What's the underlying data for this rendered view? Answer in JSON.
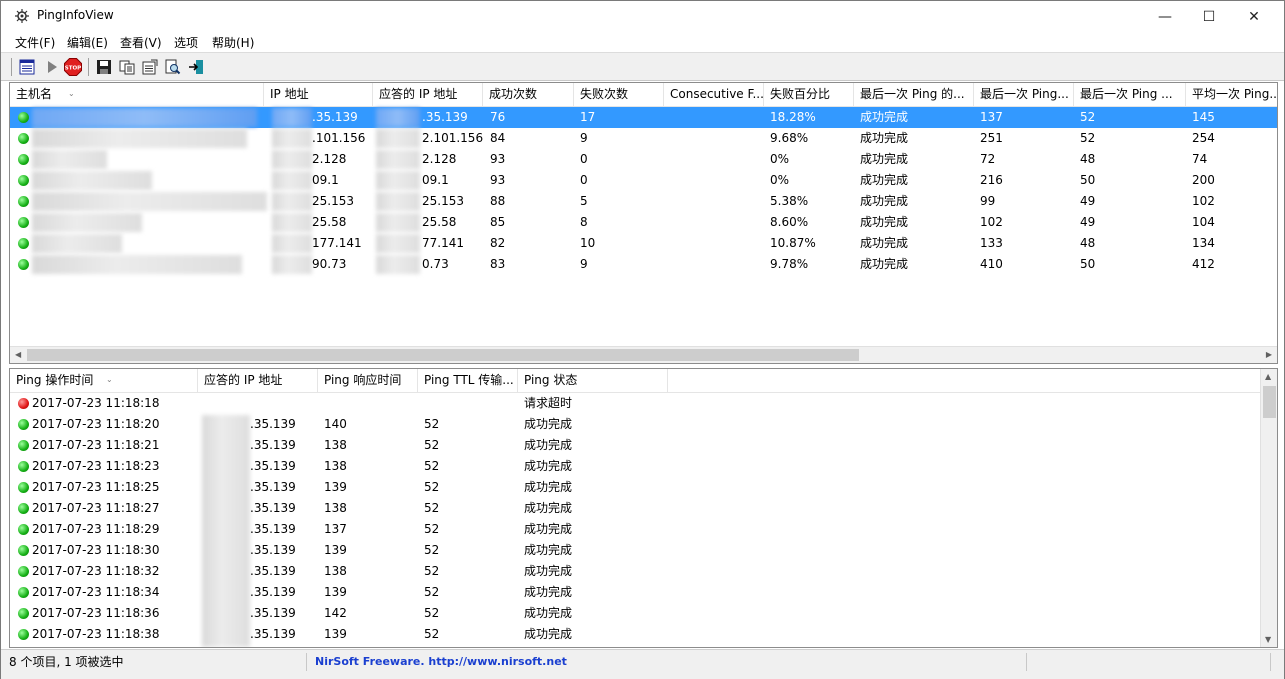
{
  "window": {
    "title": "PingInfoView",
    "minimize": "—",
    "maximize": "☐",
    "close": "✕"
  },
  "menu": [
    "文件(F)",
    "编辑(E)",
    "查看(V)",
    "选项",
    "帮助(H)"
  ],
  "toolbar_icons": [
    "list-icon",
    "play-icon",
    "stop-icon",
    "save-icon",
    "copy-icon",
    "properties-icon",
    "find-icon",
    "exit-icon"
  ],
  "stop_label": "STOP",
  "top_table": {
    "columns": [
      "主机名",
      "IP 地址",
      "应答的 IP 地址",
      "成功次数",
      "失败次数",
      "Consecutive F...",
      "失败百分比",
      "最后一次 Ping 的...",
      "最后一次 Ping...",
      "最后一次 Ping ...",
      "平均一次 Ping..."
    ],
    "rows": [
      {
        "ip": ".35.139",
        "reply_ip": ".35.139",
        "success": "76",
        "fail": "17",
        "consecutive": "",
        "fail_pct": "18.28%",
        "status": "成功完成",
        "last_time": "137",
        "last_ttl": "52",
        "avg": "145"
      },
      {
        "ip": ".101.156",
        "reply_ip": "2.101.156",
        "success": "84",
        "fail": "9",
        "consecutive": "",
        "fail_pct": "9.68%",
        "status": "成功完成",
        "last_time": "251",
        "last_ttl": "52",
        "avg": "254"
      },
      {
        "ip": "2.128",
        "reply_ip": "2.128",
        "success": "93",
        "fail": "0",
        "consecutive": "",
        "fail_pct": "0%",
        "status": "成功完成",
        "last_time": "72",
        "last_ttl": "48",
        "avg": "74"
      },
      {
        "ip": "09.1",
        "reply_ip": "09.1",
        "success": "93",
        "fail": "0",
        "consecutive": "",
        "fail_pct": "0%",
        "status": "成功完成",
        "last_time": "216",
        "last_ttl": "50",
        "avg": "200"
      },
      {
        "ip": "25.153",
        "reply_ip": "25.153",
        "success": "88",
        "fail": "5",
        "consecutive": "",
        "fail_pct": "5.38%",
        "status": "成功完成",
        "last_time": "99",
        "last_ttl": "49",
        "avg": "102"
      },
      {
        "ip": "25.58",
        "reply_ip": "25.58",
        "success": "85",
        "fail": "8",
        "consecutive": "",
        "fail_pct": "8.60%",
        "status": "成功完成",
        "last_time": "102",
        "last_ttl": "49",
        "avg": "104"
      },
      {
        "ip": "177.141",
        "reply_ip": "77.141",
        "success": "82",
        "fail": "10",
        "consecutive": "",
        "fail_pct": "10.87%",
        "status": "成功完成",
        "last_time": "133",
        "last_ttl": "48",
        "avg": "134"
      },
      {
        "ip": "90.73",
        "reply_ip": "0.73",
        "success": "83",
        "fail": "9",
        "consecutive": "",
        "fail_pct": "9.78%",
        "status": "成功完成",
        "last_time": "410",
        "last_ttl": "50",
        "avg": "412"
      }
    ]
  },
  "bottom_table": {
    "columns": [
      "Ping 操作时间",
      "应答的 IP 地址",
      "Ping 响应时间",
      "Ping TTL 传输...",
      "Ping 状态"
    ],
    "rows": [
      {
        "status_color": "red",
        "time": "2017-07-23 11:18:18",
        "reply_ip": "",
        "resp": "",
        "ttl": "",
        "status": "请求超时"
      },
      {
        "status_color": "green",
        "time": "2017-07-23 11:18:20",
        "reply_ip": ".35.139",
        "resp": "140",
        "ttl": "52",
        "status": "成功完成"
      },
      {
        "status_color": "green",
        "time": "2017-07-23 11:18:21",
        "reply_ip": ".35.139",
        "resp": "138",
        "ttl": "52",
        "status": "成功完成"
      },
      {
        "status_color": "green",
        "time": "2017-07-23 11:18:23",
        "reply_ip": ".35.139",
        "resp": "138",
        "ttl": "52",
        "status": "成功完成"
      },
      {
        "status_color": "green",
        "time": "2017-07-23 11:18:25",
        "reply_ip": ".35.139",
        "resp": "139",
        "ttl": "52",
        "status": "成功完成"
      },
      {
        "status_color": "green",
        "time": "2017-07-23 11:18:27",
        "reply_ip": ".35.139",
        "resp": "138",
        "ttl": "52",
        "status": "成功完成"
      },
      {
        "status_color": "green",
        "time": "2017-07-23 11:18:29",
        "reply_ip": ".35.139",
        "resp": "137",
        "ttl": "52",
        "status": "成功完成"
      },
      {
        "status_color": "green",
        "time": "2017-07-23 11:18:30",
        "reply_ip": ".35.139",
        "resp": "139",
        "ttl": "52",
        "status": "成功完成"
      },
      {
        "status_color": "green",
        "time": "2017-07-23 11:18:32",
        "reply_ip": ".35.139",
        "resp": "138",
        "ttl": "52",
        "status": "成功完成"
      },
      {
        "status_color": "green",
        "time": "2017-07-23 11:18:34",
        "reply_ip": ".35.139",
        "resp": "139",
        "ttl": "52",
        "status": "成功完成"
      },
      {
        "status_color": "green",
        "time": "2017-07-23 11:18:36",
        "reply_ip": ".35.139",
        "resp": "142",
        "ttl": "52",
        "status": "成功完成"
      },
      {
        "status_color": "green",
        "time": "2017-07-23 11:18:38",
        "reply_ip": ".35.139",
        "resp": "139",
        "ttl": "52",
        "status": "成功完成"
      }
    ]
  },
  "status": {
    "count_text": "8 个项目, 1 项被选中",
    "link_text": "NirSoft Freeware.  http://www.nirsoft.net"
  }
}
